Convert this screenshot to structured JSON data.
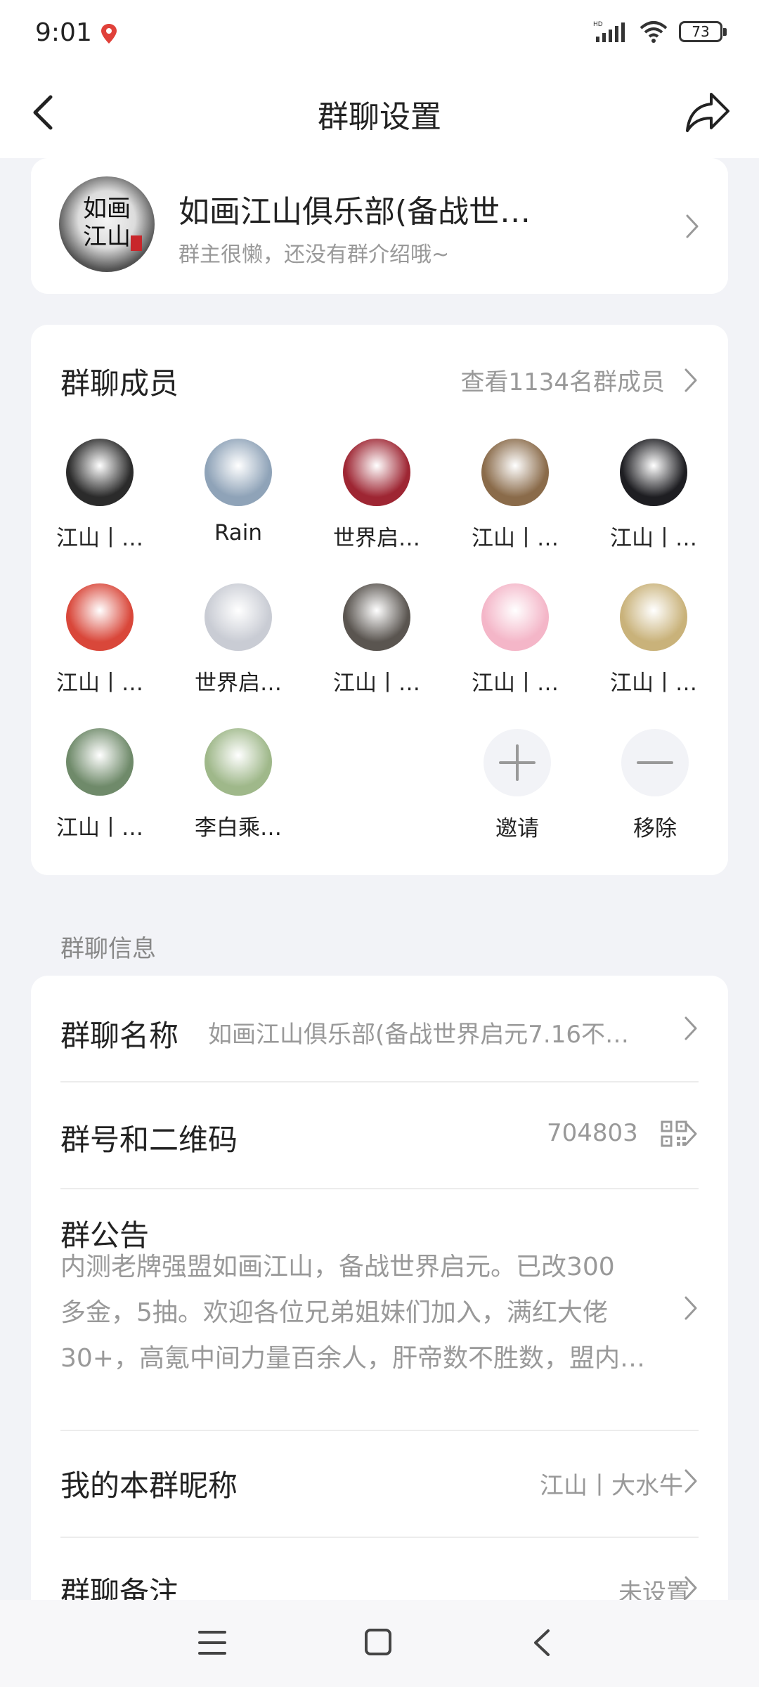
{
  "status_bar": {
    "time": "9:01",
    "battery": "73"
  },
  "header": {
    "title": "群聊设置"
  },
  "group": {
    "name": "如画江山俱乐部(备战世…",
    "description": "群主很懒，还没有群介绍哦~",
    "avatar_text": "如画江山"
  },
  "members": {
    "title": "群聊成员",
    "view_all": "查看1134名群成员",
    "items": [
      {
        "name": "江山丨…",
        "color": "#2b2b2b"
      },
      {
        "name": "Rain",
        "color": "#8fa3b8"
      },
      {
        "name": "世界启…",
        "color": "#9e2633"
      },
      {
        "name": "江山丨…",
        "color": "#8a6b4a"
      },
      {
        "name": "江山丨…",
        "color": "#1e1e22"
      },
      {
        "name": "江山丨…",
        "color": "#d9473a"
      },
      {
        "name": "世界启…",
        "color": "#c9ccd4"
      },
      {
        "name": "江山丨…",
        "color": "#5a5550"
      },
      {
        "name": "江山丨…",
        "color": "#f4b6c8"
      },
      {
        "name": "江山丨…",
        "color": "#c9b27a"
      },
      {
        "name": "江山丨…",
        "color": "#6f8a6a"
      },
      {
        "name": "李白乘…",
        "color": "#9fb88a"
      }
    ],
    "invite_label": "邀请",
    "remove_label": "移除"
  },
  "info": {
    "section_title": "群聊信息",
    "group_name_label": "群聊名称",
    "group_name_value": "如画江山俱乐部(备战世界启元7.16不…",
    "group_id_label": "群号和二维码",
    "group_id_value": "704803",
    "notice_label": "群公告",
    "notice_lines": [
      "内测老牌强盟如画江山，备战世界启元。已改300",
      "多金，5抽。欢迎各位兄弟姐妹们加入，满红大佬",
      "30+，高氪中间力量百余人，肝帝数不胜数，盟内…"
    ],
    "nickname_label": "我的本群昵称",
    "nickname_value": "江山丨大水牛",
    "remark_label": "群聊备注",
    "remark_value": "未设置"
  }
}
